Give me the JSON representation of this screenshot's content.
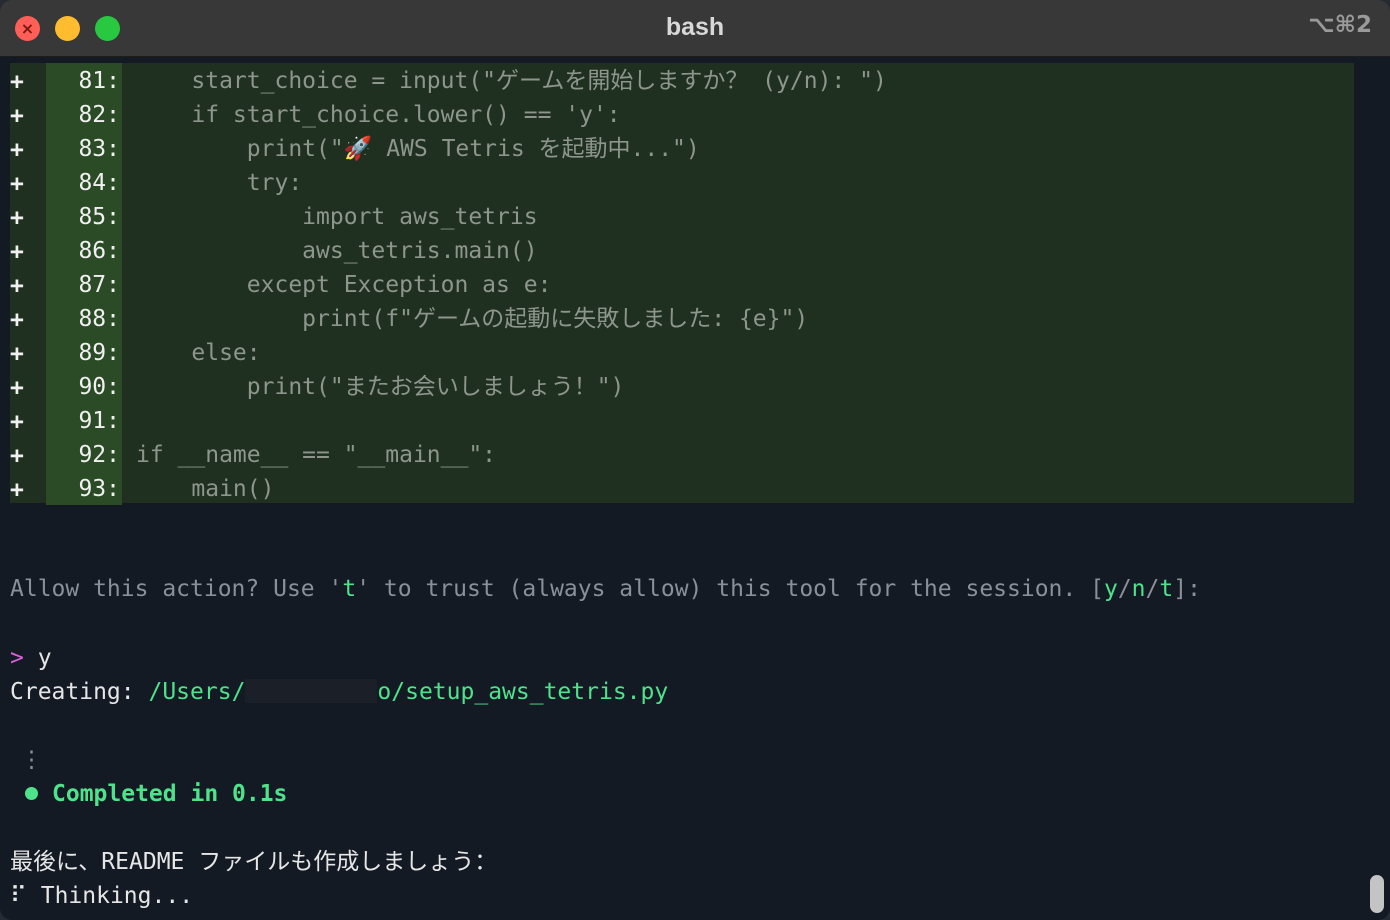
{
  "window": {
    "title": "bash",
    "shortcut": "⌥⌘2"
  },
  "diff": {
    "rows": [
      {
        "sign": "+",
        "num": "81:",
        "code": "    start_choice = input(\"ゲームを開始しますか？ (y/n): \")"
      },
      {
        "sign": "+",
        "num": "82:",
        "code": "    if start_choice.lower() == 'y':"
      },
      {
        "sign": "+",
        "num": "83:",
        "code": "        print(\"🚀 AWS Tetris を起動中...\")"
      },
      {
        "sign": "+",
        "num": "84:",
        "code": "        try:"
      },
      {
        "sign": "+",
        "num": "85:",
        "code": "            import aws_tetris"
      },
      {
        "sign": "+",
        "num": "86:",
        "code": "            aws_tetris.main()"
      },
      {
        "sign": "+",
        "num": "87:",
        "code": "        except Exception as e:"
      },
      {
        "sign": "+",
        "num": "88:",
        "code": "            print(f\"ゲームの起動に失敗しました: {e}\")"
      },
      {
        "sign": "+",
        "num": "89:",
        "code": "    else:"
      },
      {
        "sign": "+",
        "num": "90:",
        "code": "        print(\"またお会いしましょう！\")"
      },
      {
        "sign": "+",
        "num": "91:",
        "code": ""
      },
      {
        "sign": "+",
        "num": "92:",
        "code": "if __name__ == \"__main__\":"
      },
      {
        "sign": "+",
        "num": "93:",
        "code": "    main()"
      }
    ]
  },
  "prompt_line": {
    "before": "Allow this action? Use '",
    "t_key": "t",
    "middle": "' to trust (always allow) this tool for the session. [",
    "y": "y",
    "sep1": "/",
    "n": "n",
    "sep2": "/",
    "t": "t",
    "after": "]:"
  },
  "input_line": {
    "marker": ">",
    "value": "y"
  },
  "creating_line": {
    "label": "Creating:",
    "path_start": "/Users/",
    "path_end": "o/setup_aws_tetris.py"
  },
  "status": {
    "spinner": "⋮",
    "completed": "Completed in 0.1s"
  },
  "message": "最後に、README ファイルも作成しましょう：",
  "thinking": {
    "spinner": "⠏",
    "text": "Thinking..."
  },
  "colors": {
    "diff_bg": "#1f3020",
    "gutter_bg": "#2b4a26",
    "accent_green": "#4ee38a",
    "prompt_magenta": "#d860d8"
  }
}
